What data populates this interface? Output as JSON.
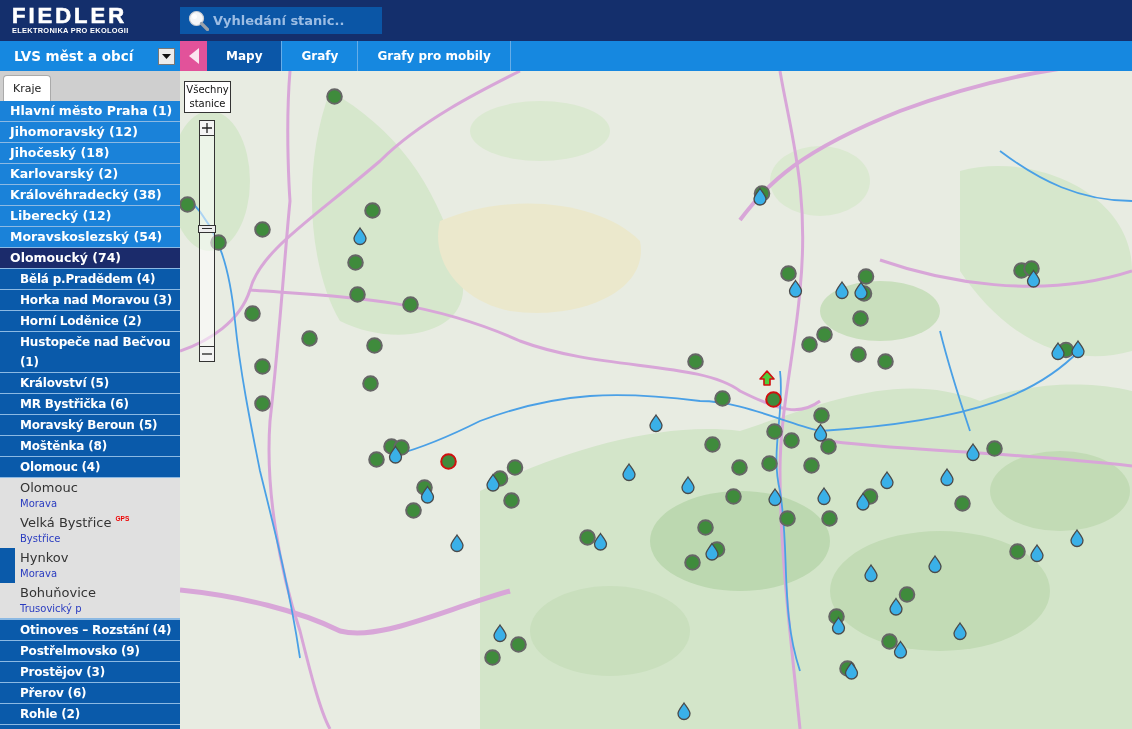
{
  "header": {
    "logo": {
      "title": "FIEDLER",
      "subtitle": "ELEKTRONIKA PRO EKOLOGII"
    },
    "search": {
      "placeholder": "Vyhledání stanic.."
    }
  },
  "navbar": {
    "network": {
      "label": "LVS měst a obcí"
    },
    "tabs": [
      {
        "label": "Mapy",
        "selected": true
      },
      {
        "label": "Grafy",
        "selected": false
      },
      {
        "label": "Grafy pro mobily",
        "selected": false
      }
    ]
  },
  "sidebar": {
    "tabs": [
      {
        "label": "Kraje",
        "selected": true
      }
    ],
    "regions": [
      {
        "label": "Hlavní město Praha (1)",
        "selected": false
      },
      {
        "label": "Jihomoravský (12)",
        "selected": false
      },
      {
        "label": "Jihočeský (18)",
        "selected": false
      },
      {
        "label": "Karlovarský (2)",
        "selected": false
      },
      {
        "label": "Královéhradecký (38)",
        "selected": false
      },
      {
        "label": "Liberecký (12)",
        "selected": false
      },
      {
        "label": "Moravskoslezský (54)",
        "selected": false
      },
      {
        "label": "Olomoucký (74)",
        "selected": true,
        "children": [
          {
            "label": "Bělá p.Pradědem (4)"
          },
          {
            "label": "Horka nad Moravou (3)"
          },
          {
            "label": "Horní Loděnice (2)"
          },
          {
            "label": "Hustopeče nad Bečvou (1)"
          },
          {
            "label": "Království (5)"
          },
          {
            "label": "MR Bystřička (6)"
          },
          {
            "label": "Moravský Beroun (5)"
          },
          {
            "label": "Moštěnka (8)"
          },
          {
            "label": "Olomouc (4)",
            "stations": [
              {
                "name": "Olomouc",
                "river": "Morava",
                "selected": false
              },
              {
                "name": "Velká Bystřice",
                "badge": "GPS",
                "river": "Bystřice",
                "selected": false
              },
              {
                "name": "Hynkov",
                "river": "Morava",
                "selected": true
              },
              {
                "name": "Bohuňovice",
                "river": "Trusovický p",
                "selected": false
              }
            ]
          },
          {
            "label": "Otinoves – Rozstání (4)"
          },
          {
            "label": "Postřelmovsko (9)"
          },
          {
            "label": "Prostějov (3)"
          },
          {
            "label": "Přerov (6)"
          },
          {
            "label": "Rohle (2)"
          }
        ]
      }
    ]
  },
  "map": {
    "all_stations_button": "Všechny stanice",
    "zoom": {
      "level": 0.56
    }
  }
}
